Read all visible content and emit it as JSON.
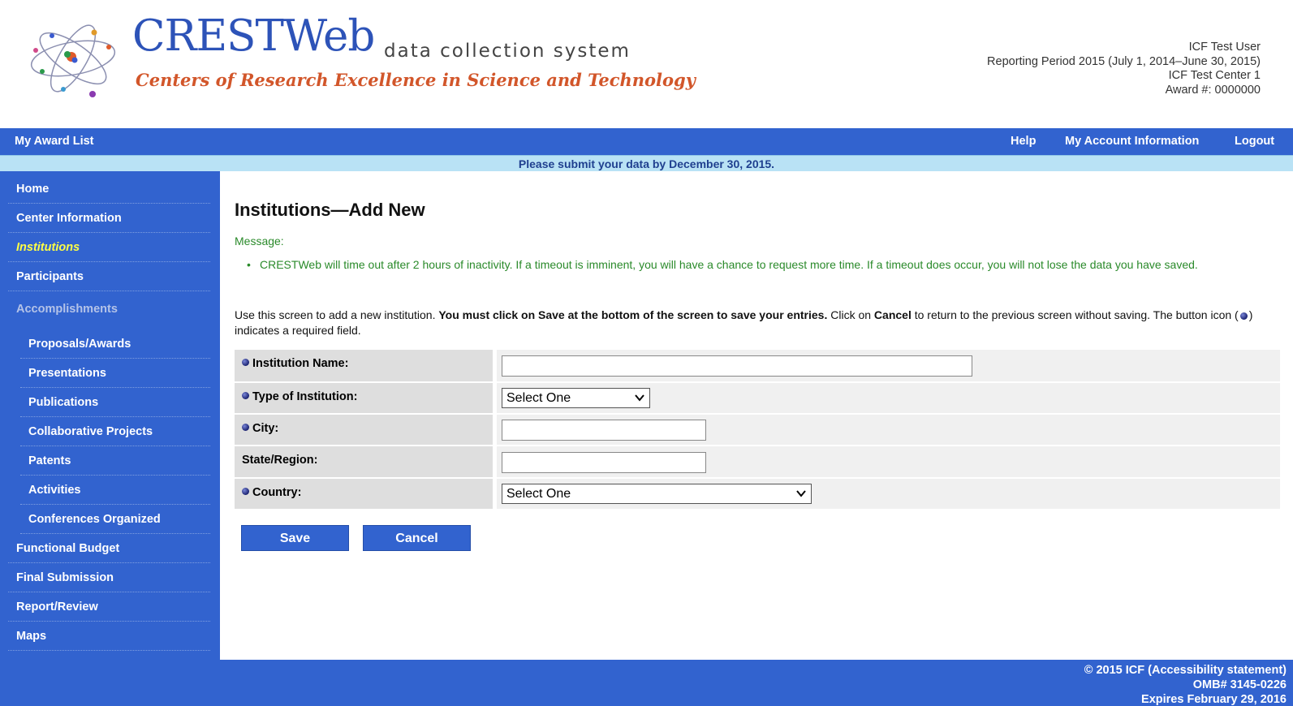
{
  "header": {
    "logo_title": "CRESTWeb",
    "logo_subtitle": "data collection system",
    "logo_tagline": "Centers of Research Excellence in Science and Technology",
    "user_name": "ICF Test User",
    "reporting_period": "Reporting Period 2015 (July 1, 2014–June 30, 2015)",
    "center": "ICF Test Center 1",
    "award": "Award #: 0000000"
  },
  "topnav": {
    "award_list": "My Award List",
    "help": "Help",
    "account": "My Account Information",
    "logout": "Logout"
  },
  "notice": "Please submit your data by December 30, 2015.",
  "sidebar": {
    "items": [
      {
        "label": "Home"
      },
      {
        "label": "Center Information"
      },
      {
        "label": "Institutions"
      },
      {
        "label": "Participants"
      },
      {
        "label": "Accomplishments"
      },
      {
        "label": "Proposals/Awards"
      },
      {
        "label": "Presentations"
      },
      {
        "label": "Publications"
      },
      {
        "label": "Collaborative Projects"
      },
      {
        "label": "Patents"
      },
      {
        "label": "Activities"
      },
      {
        "label": "Conferences Organized"
      },
      {
        "label": "Functional Budget"
      },
      {
        "label": "Final Submission"
      },
      {
        "label": "Report/Review"
      },
      {
        "label": "Maps"
      }
    ]
  },
  "main": {
    "title": "Institutions—Add New",
    "message_label": "Message:",
    "message_text": "CRESTWeb will time out after 2 hours of inactivity. If a timeout is imminent, you will have a chance to request more time. If a timeout does occur, you will not lose the data you have saved.",
    "instr_1": "Use this screen to add a new institution. ",
    "instr_2": "You must click on Save at the bottom of the screen to save your entries.",
    "instr_3": " Click on ",
    "instr_4": "Cancel",
    "instr_5": " to return to the previous screen without saving. The button icon (",
    "instr_6": ") indicates a required field.",
    "form": {
      "institution_name_label": "Institution Name:",
      "institution_name_value": "",
      "type_label": "Type of Institution:",
      "type_value": "Select One",
      "city_label": "City:",
      "city_value": "",
      "state_label": "State/Region:",
      "state_value": "",
      "country_label": "Country:",
      "country_value": "Select One"
    },
    "save_label": "Save",
    "cancel_label": "Cancel"
  },
  "footer": {
    "copyright": "© 2015 ICF (Accessibility statement)",
    "omb": "OMB# 3145-0226",
    "expires": "Expires February 29, 2016"
  },
  "colors": {
    "brand_blue": "#3263cf",
    "notice_bg": "#b9e2f5",
    "message_green": "#2a8a2a",
    "active_nav": "#ffff44"
  }
}
